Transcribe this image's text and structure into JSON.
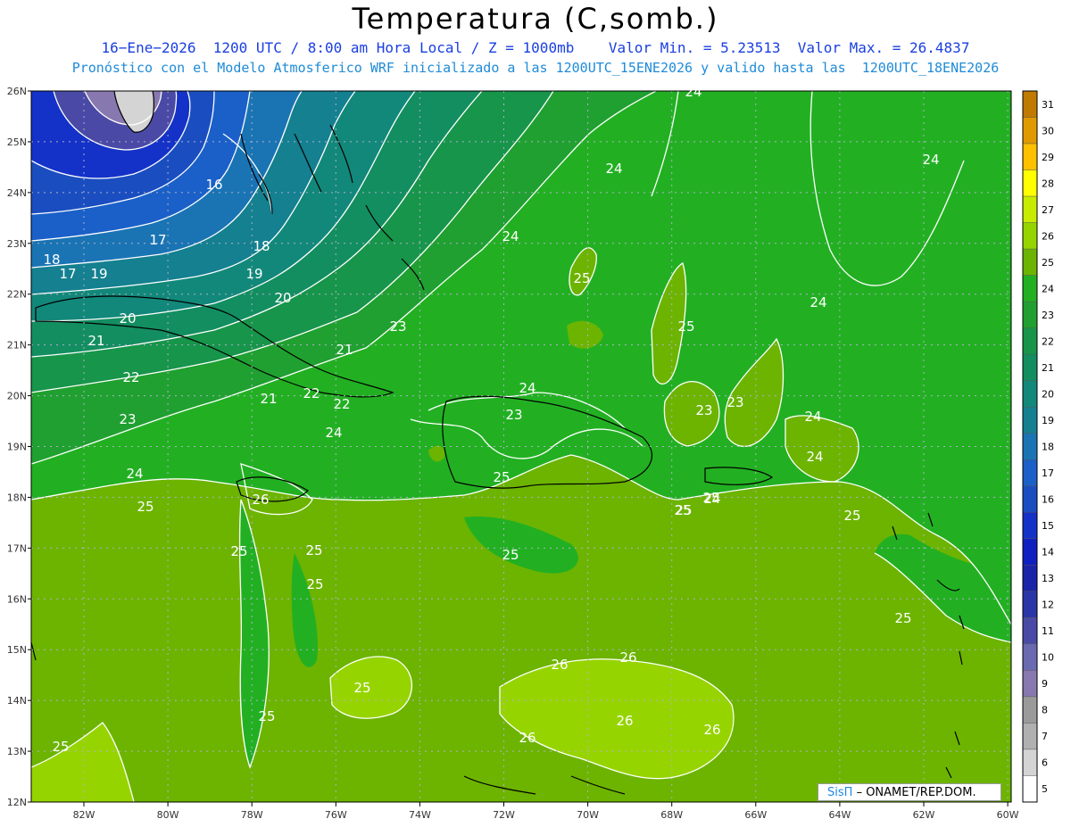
{
  "header": {
    "title": "Temperatura (C,somb.)",
    "subtitle": "16−Ene−2026  1200 UTC / 8:00 am Hora Local / Z = 1000mb    Valor Min. = 5.23513  Valor Max. = 26.4837",
    "forecast_note": "Pronóstico con el Modelo Atmosferico WRF inicializado a las 1200UTC_15ENE2026 y valido hasta las  1200UTC_18ENE2026"
  },
  "map": {
    "lon_labels": [
      "82W",
      "80W",
      "78W",
      "76W",
      "74W",
      "72W",
      "70W",
      "68W",
      "66W",
      "64W",
      "62W",
      "60W"
    ],
    "lat_labels": [
      "26N",
      "25N",
      "24N",
      "23N",
      "22N",
      "21N",
      "20N",
      "19N",
      "18N",
      "17N",
      "16N",
      "15N",
      "14N",
      "13N",
      "12N"
    ],
    "contour_labels": [
      "16",
      "17",
      "18",
      "18",
      "19",
      "17",
      "19",
      "20",
      "20",
      "21",
      "21",
      "22",
      "22",
      "21",
      "23",
      "22",
      "23",
      "24",
      "24",
      "23",
      "24",
      "24",
      "24",
      "24",
      "24",
      "24",
      "25",
      "25",
      "23",
      "23",
      "24",
      "24",
      "25",
      "25",
      "25",
      "25",
      "25",
      "25",
      "25",
      "25",
      "25",
      "25",
      "25",
      "25",
      "25",
      "26",
      "26",
      "26",
      "26",
      "26",
      "26",
      "24",
      "25"
    ]
  },
  "colorbar": {
    "labels": [
      "31",
      "30",
      "29",
      "28",
      "27",
      "26",
      "25",
      "24",
      "23",
      "22",
      "21",
      "20",
      "19",
      "18",
      "17",
      "16",
      "15",
      "14",
      "13",
      "12",
      "11",
      "10",
      "9",
      "8",
      "7",
      "6",
      "5"
    ],
    "colors": [
      "#c07a00",
      "#e09a00",
      "#ffc000",
      "#ffff00",
      "#c8ec00",
      "#96d400",
      "#6cb400",
      "#22b022",
      "#20a030",
      "#17954a",
      "#138e60",
      "#12887a",
      "#148090",
      "#1a74b4",
      "#1a60c8",
      "#1a4ec0",
      "#1432c8",
      "#1020c0",
      "#1a24a8",
      "#2a36a8",
      "#4a4aa6",
      "#6a6ab0",
      "#8878b0",
      "#9a9a9a",
      "#b0b0b0",
      "#d4d4d4",
      "#ffffff"
    ]
  },
  "credit": {
    "brand": "SisΠ",
    "org": "– ONAMET/REP.DOM."
  }
}
